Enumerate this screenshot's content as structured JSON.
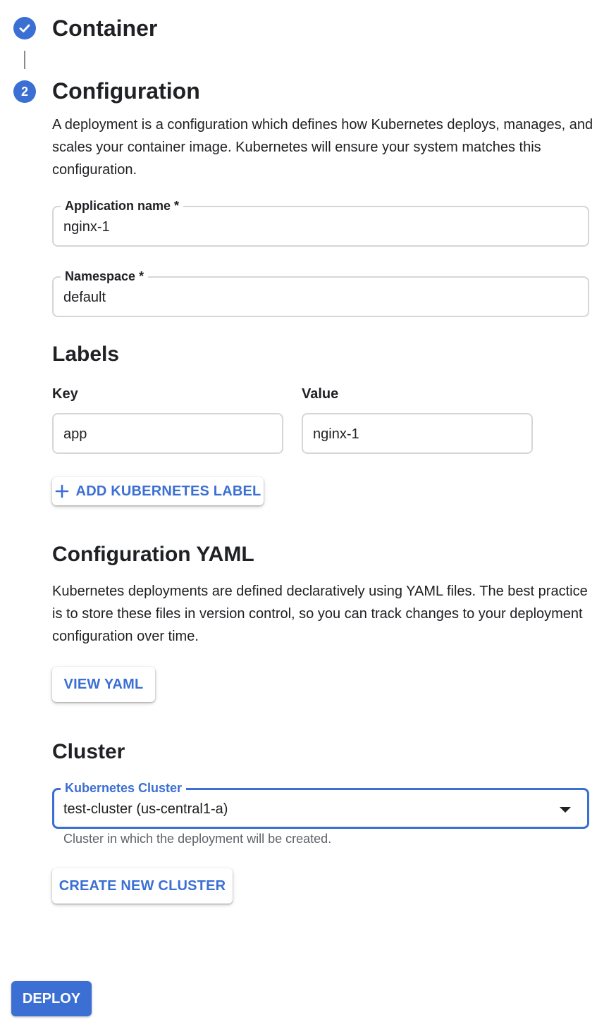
{
  "steps": [
    {
      "number": "",
      "title": "Container",
      "status": "completed"
    },
    {
      "number": "2",
      "title": "Configuration",
      "status": "active"
    }
  ],
  "configuration": {
    "description": "A deployment is a configuration which defines how Kubernetes deploys, manages, and scales your container image. Kubernetes will ensure your system matches this configuration.",
    "app_name": {
      "label": "Application name *",
      "value": "nginx-1"
    },
    "namespace": {
      "label": "Namespace *",
      "value": "default"
    }
  },
  "labels": {
    "title": "Labels",
    "key_header": "Key",
    "value_header": "Value",
    "rows": [
      {
        "key": "app",
        "value": "nginx-1"
      }
    ],
    "add_button": "ADD KUBERNETES LABEL"
  },
  "yaml": {
    "title": "Configuration YAML",
    "description": "Kubernetes deployments are defined declaratively using YAML files. The best practice is to store these files in version control, so you can track changes to your deployment configuration over time.",
    "view_button": "VIEW YAML"
  },
  "cluster": {
    "title": "Cluster",
    "select_label": "Kubernetes Cluster",
    "select_value": "test-cluster (us-central1-a)",
    "hint": "Cluster in which the deployment will be created.",
    "create_button": "CREATE NEW CLUSTER"
  },
  "deploy_button": "DEPLOY",
  "colors": {
    "accent": "#3b6fd4",
    "text": "#202124",
    "muted": "#5f6368",
    "border": "#d6d6d6"
  },
  "icons": {
    "completed_step": "check-icon",
    "add": "plus-icon",
    "dropdown": "caret-down-icon"
  }
}
